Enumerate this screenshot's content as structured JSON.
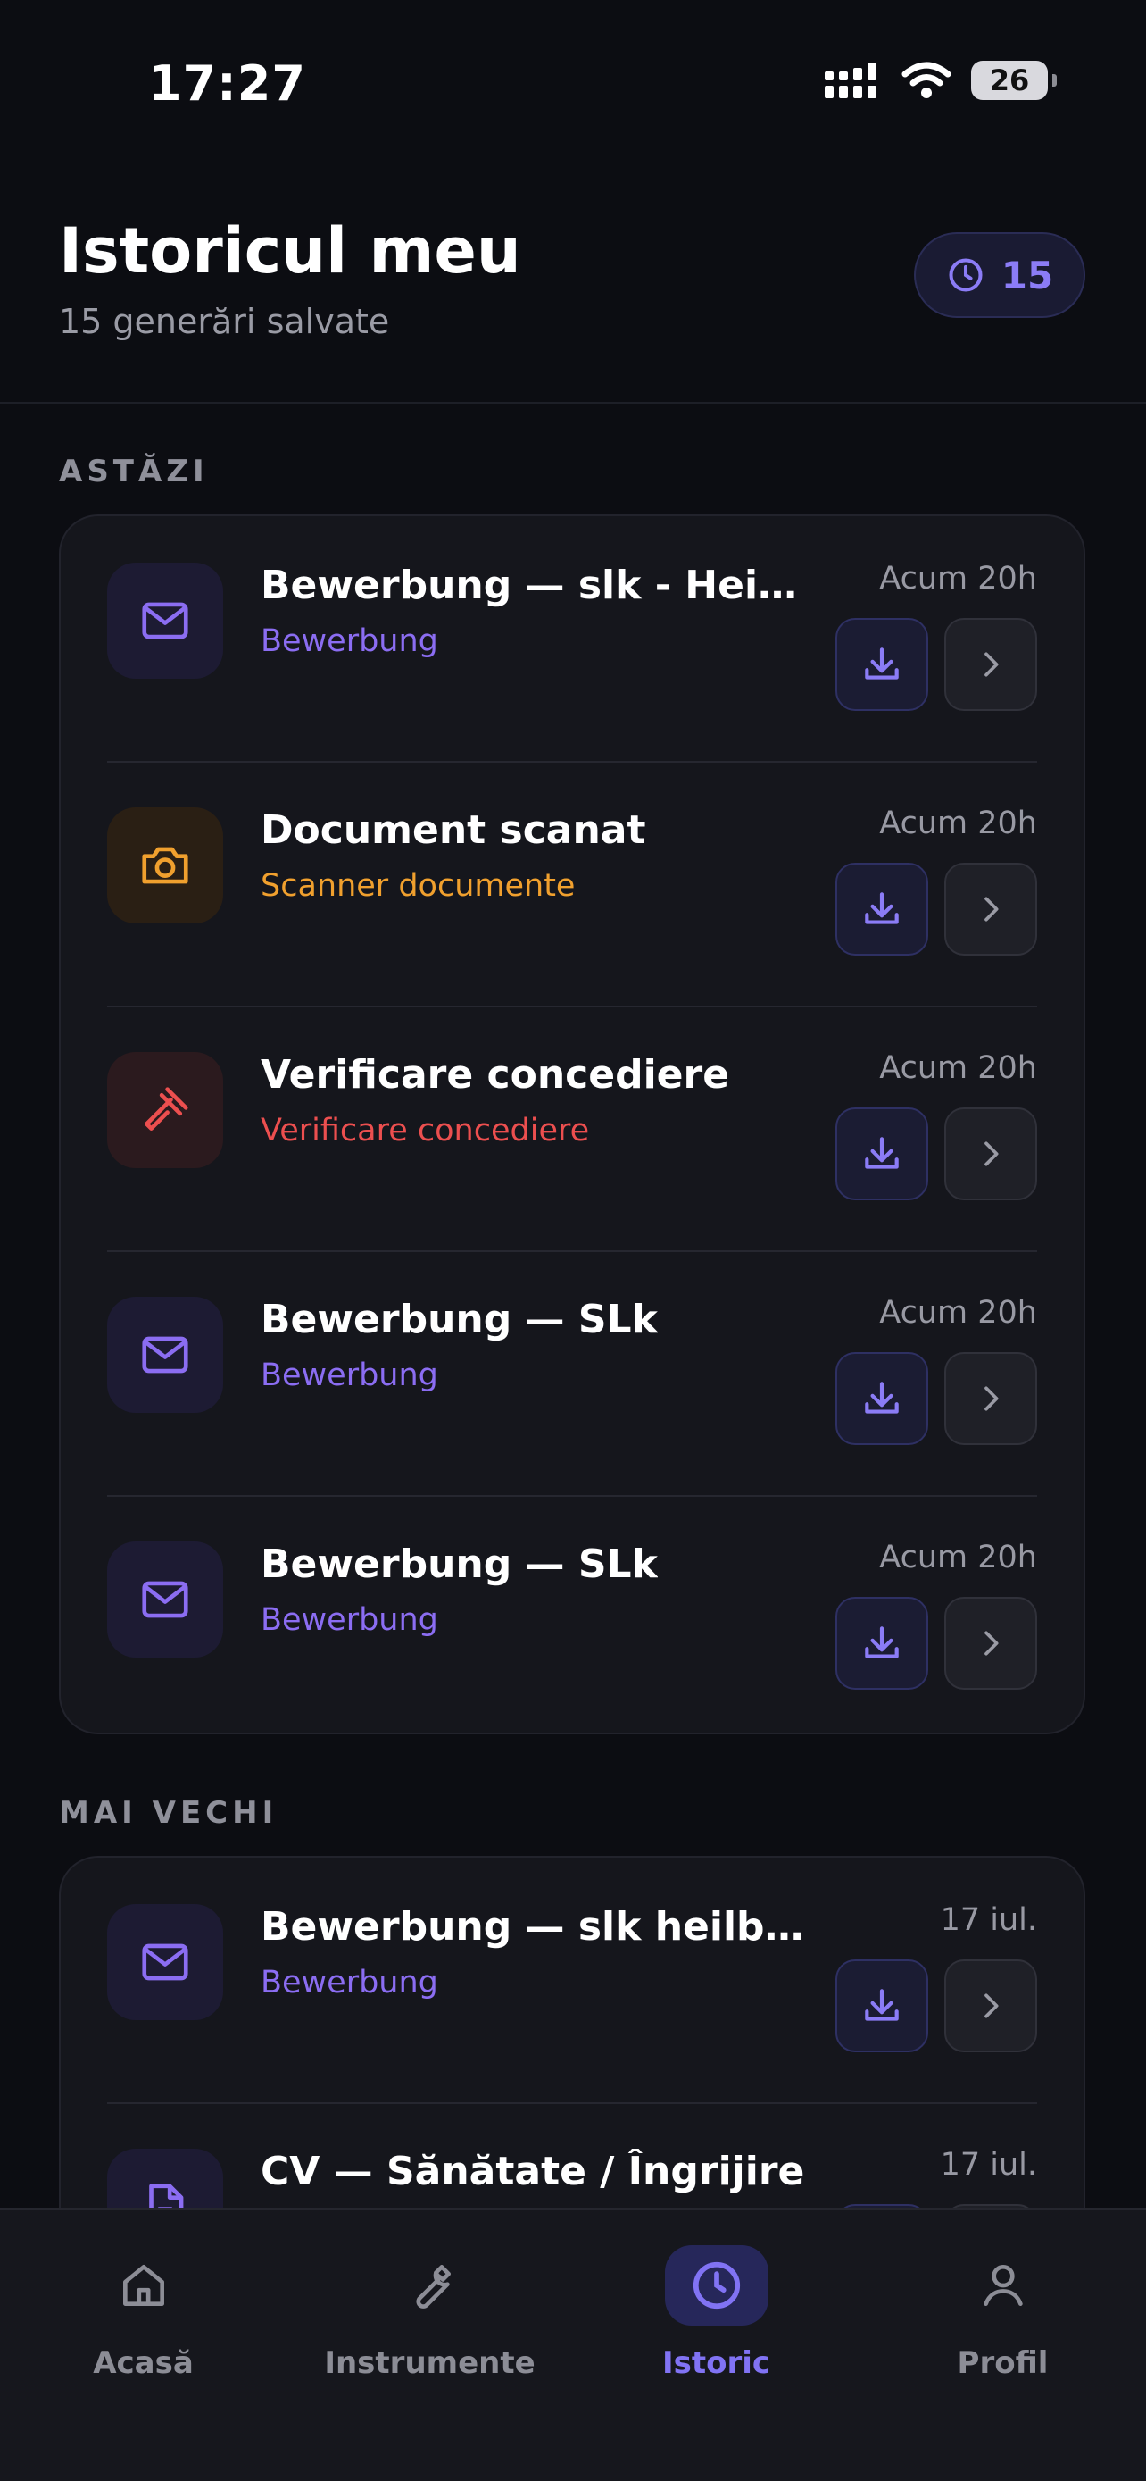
{
  "status_bar": {
    "time": "17:27",
    "battery": "26"
  },
  "header": {
    "title": "Istoricul meu",
    "subtitle": "15 generări salvate",
    "count": "15"
  },
  "sections": [
    {
      "label": "ASTĂZI"
    },
    {
      "label": "MAI VECHI"
    }
  ],
  "today_items": [
    {
      "title": "Bewerbung — slk - Heilbr...",
      "category": "Bewerbung",
      "time": "Acum 20h",
      "icon": "mail-icon",
      "accent": "violet"
    },
    {
      "title": "Document scanat",
      "category": "Scanner documente",
      "time": "Acum 20h",
      "icon": "camera-icon",
      "accent": "orange"
    },
    {
      "title": "Verificare concediere",
      "category": "Verificare concediere",
      "time": "Acum 20h",
      "icon": "gavel-icon",
      "accent": "red"
    },
    {
      "title": "Bewerbung — SLk",
      "category": "Bewerbung",
      "time": "Acum 20h",
      "icon": "mail-icon",
      "accent": "violet"
    },
    {
      "title": "Bewerbung — SLk",
      "category": "Bewerbung",
      "time": "Acum 20h",
      "icon": "mail-icon",
      "accent": "violet"
    }
  ],
  "older_items": [
    {
      "title": "Bewerbung — slk heilbronn",
      "category": "Bewerbung",
      "time": "17 iul.",
      "icon": "mail-icon",
      "accent": "violet"
    },
    {
      "title": "CV — Sănătate / Îngrijire",
      "category": "",
      "time": "17 iul.",
      "icon": "document-icon",
      "accent": "violet"
    }
  ],
  "tabs": [
    {
      "label": "Acasă",
      "icon": "home-icon"
    },
    {
      "label": "Instrumente",
      "icon": "wrench-icon"
    },
    {
      "label": "Istoric",
      "icon": "clock-icon",
      "active": true
    },
    {
      "label": "Profil",
      "icon": "user-icon"
    }
  ],
  "colors": {
    "violet": "#8b6df2",
    "orange": "#f0a02e",
    "red": "#ec4f4f",
    "background": "#0c0d12",
    "card": "#15161c"
  }
}
